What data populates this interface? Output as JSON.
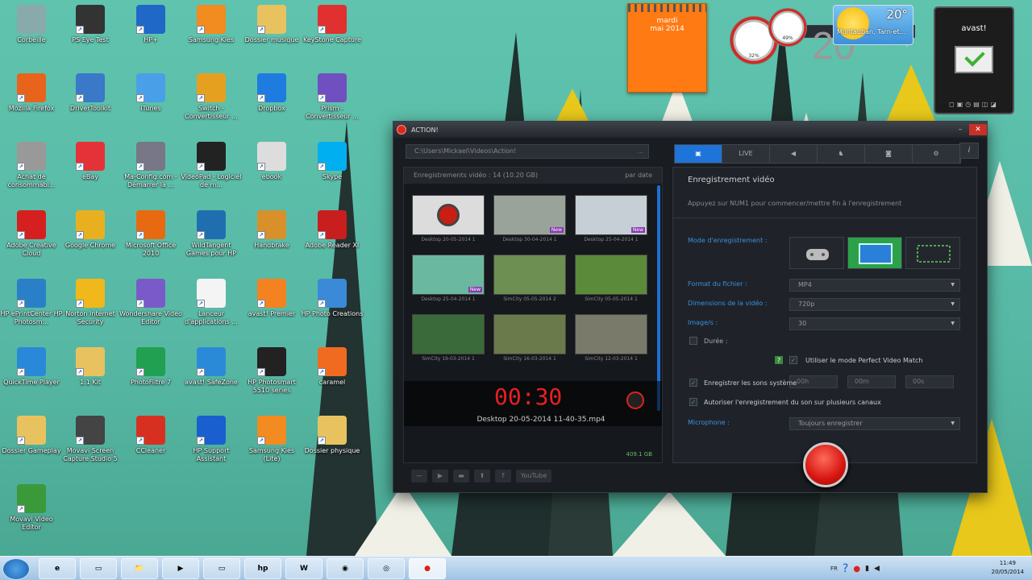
{
  "desktop_icons": [
    {
      "label": "Corbeille",
      "color": "#8aa"
    },
    {
      "label": "PS Eye Test",
      "color": "#333"
    },
    {
      "label": "HP+",
      "color": "#2068c8"
    },
    {
      "label": "Samsung Kies",
      "color": "#f28b20"
    },
    {
      "label": "Dossier musique",
      "color": "#e9c260"
    },
    {
      "label": "KeyStone Capture",
      "color": "#e03030"
    },
    {
      "label": "Mozilla Firefox",
      "color": "#e8641c"
    },
    {
      "label": "DriverToolkit",
      "color": "#3a78c8"
    },
    {
      "label": "iTunes",
      "color": "#4aa0e8"
    },
    {
      "label": "Switch - Convertisseur ...",
      "color": "#e6a020"
    },
    {
      "label": "Dropbox",
      "color": "#1e7be0"
    },
    {
      "label": "Prism - Convertisseur ...",
      "color": "#7050c0"
    },
    {
      "label": "Achat de consommabl...",
      "color": "#999"
    },
    {
      "label": "eBay",
      "color": "#e53238"
    },
    {
      "label": "Ma-Config.com - Démarrer la ...",
      "color": "#778"
    },
    {
      "label": "VideoPad - Logiciel de m...",
      "color": "#222"
    },
    {
      "label": "ebook",
      "color": "#ddd"
    },
    {
      "label": "Skype",
      "color": "#00aff0"
    },
    {
      "label": "Adobe Creative Cloud",
      "color": "#d62020"
    },
    {
      "label": "Google Chrome",
      "color": "#e8b020"
    },
    {
      "label": "Microsoft Office 2010",
      "color": "#e86a10"
    },
    {
      "label": "WildTangent Games pour HP",
      "color": "#1f6fb0"
    },
    {
      "label": "Handbrake",
      "color": "#d8902a"
    },
    {
      "label": "Adobe Reader XI",
      "color": "#c81e1e"
    },
    {
      "label": "HP ePrintCenter HP Photosm...",
      "color": "#2a80c8"
    },
    {
      "label": "Norton Internet Security",
      "color": "#f0b81a"
    },
    {
      "label": "Wondershare Video Editor",
      "color": "#7a5ac8"
    },
    {
      "label": "Lanceur d'applications ...",
      "color": "#f4f4f4"
    },
    {
      "label": "avast! Premier",
      "color": "#f58220"
    },
    {
      "label": "HP Photo Creations",
      "color": "#3a8ad8"
    },
    {
      "label": "QuickTime Player",
      "color": "#2a88d8"
    },
    {
      "label": "1.1 Kit",
      "color": "#e9c260"
    },
    {
      "label": "PhotoFiltre 7",
      "color": "#20a050"
    },
    {
      "label": "avast! SafeZone",
      "color": "#2a8ad8"
    },
    {
      "label": "HP Photosmart 5510 series",
      "color": "#222"
    },
    {
      "label": "caramel",
      "color": "#f06a20"
    },
    {
      "label": "Dossier Gameplay",
      "color": "#e9c260"
    },
    {
      "label": "Movavi Screen Capture Studio 5",
      "color": "#444"
    },
    {
      "label": "CCleaner",
      "color": "#d83020"
    },
    {
      "label": "HP Support Assistant",
      "color": "#1a5fd0"
    },
    {
      "label": "Samsung Kies (Lite)",
      "color": "#f28b20"
    },
    {
      "label": "Dossier physique",
      "color": "#e9c260"
    },
    {
      "label": "Movavi Video Editor",
      "color": "#3a9a3a"
    }
  ],
  "calendar": {
    "day_name": "mardi",
    "day": "20",
    "month_year": "mai 2014"
  },
  "gauges": [
    "32%",
    "49%"
  ],
  "weather": {
    "temp": "20°",
    "city": "Montauban, Tarn-et..."
  },
  "avast_gadget": {
    "logo": "avast!",
    "toolbar": "◻▣◷▤◫◪"
  },
  "window": {
    "title": "ACTION!",
    "path": "C:\\Users\\Mickael\\Videos\\Action!",
    "gallery_header": "Enregistrements vidéo : 14 (10.20 GB)",
    "sort_label": "par date",
    "thumbs": [
      {
        "label": "Desktop 20-05-2014 1",
        "color": "#dcdcdc",
        "new": false
      },
      {
        "label": "Desktop 30-04-2014 1",
        "color": "#9aa39a",
        "new": true
      },
      {
        "label": "Desktop 25-04-2014 1",
        "color": "#c6cfd6",
        "new": true
      },
      {
        "label": "Desktop 25-04-2014 1",
        "color": "#6ab8a0",
        "new": true
      },
      {
        "label": "SimCity 05-05-2014 2",
        "color": "#6d8f52",
        "new": false
      },
      {
        "label": "SimCity 05-05-2014 1",
        "color": "#5a8a3a",
        "new": false
      },
      {
        "label": "SimCity 19-03-2014 1",
        "color": "#3a6a3a",
        "new": false
      },
      {
        "label": "SimCity 16-03-2014 1",
        "color": "#6a7a4a",
        "new": false
      },
      {
        "label": "SimCity 12-03-2014 1",
        "color": "#7a7a6a",
        "new": false
      }
    ],
    "new_badge": "New",
    "timer": "00:30",
    "current_file": "Desktop 20-05-2014 11-40-35.mp4",
    "free_space": "409.1 GB",
    "bottom_buttons": [
      "—",
      "▶",
      "▬",
      "⬆",
      "f",
      "YouTube"
    ],
    "tabs": [
      "▣",
      "LIVE",
      "◀",
      "♞",
      "◙",
      "⚙"
    ],
    "info": "i",
    "panel_title": "Enregistrement vidéo",
    "panel_hint": "Appuyez sur NUM1 pour commencer/mettre fin à l'enregistrement",
    "mode_label": "Mode d'enregistrement :",
    "format_label": "Format du fichier :",
    "format_value": "MP4",
    "dim_label": "Dimensions de la vidéo :",
    "dim_value": "720p",
    "fps_label": "Image/s :",
    "fps_value": "30",
    "duration_label": "Durée :",
    "dur_h": "00h",
    "dur_m": "00m",
    "dur_s": "00s",
    "pvm_help": "?",
    "pvm_label": "Utiliser le mode Perfect Video Match",
    "sys_sound_label": "Enregistrer les sons système",
    "multi_label": "Autoriser l'enregistrement du son sur plusieurs canaux",
    "mic_label": "Microphone :",
    "mic_value": "Toujours enregistrer"
  },
  "taskbar": {
    "items": [
      "e",
      "▭",
      "📁",
      "▶",
      "▭",
      "hp",
      "W",
      "◉",
      "◎",
      "●"
    ],
    "lang": "FR",
    "time": "11:49",
    "date": "20/05/2014"
  }
}
